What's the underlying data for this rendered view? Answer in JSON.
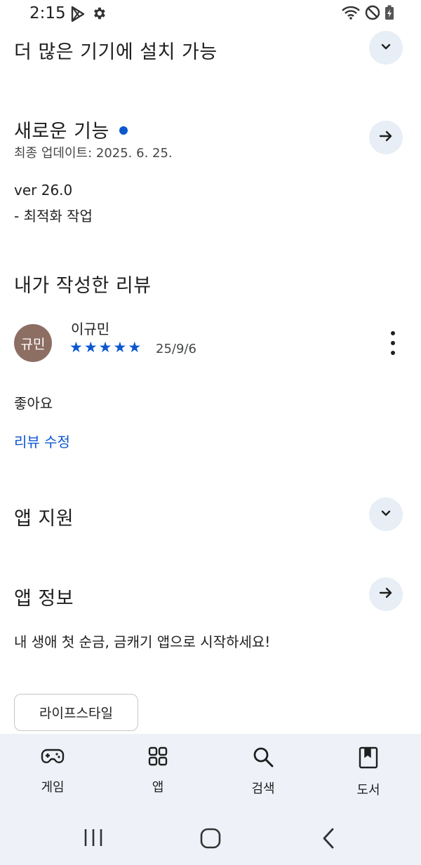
{
  "status_bar": {
    "time": "2:15",
    "left_icons": [
      "play-store-icon",
      "settings-gear-icon"
    ],
    "right_icons": [
      "wifi-icon",
      "do-not-disturb-icon",
      "battery-charging-icon"
    ]
  },
  "devices_section": {
    "title": "더 많은 기기에 설치 가능",
    "toggle_icon": "chevron-down-icon"
  },
  "whats_new": {
    "title": "새로운 기능",
    "last_updated": "최종 업데이트: 2025. 6. 25.",
    "version": "ver 26.0",
    "notes": "- 최적화 작업",
    "arrow_icon": "arrow-right-icon"
  },
  "my_review": {
    "title": "내가 작성한 리뷰",
    "avatar_initials": "규민",
    "reviewer_name": "이규민",
    "rating": 5,
    "stars": [
      "★",
      "★",
      "★",
      "★",
      "★"
    ],
    "date": "25/9/6",
    "text": "좋아요",
    "edit_label": "리뷰 수정"
  },
  "app_support": {
    "title": "앱 지원",
    "toggle_icon": "chevron-down-icon"
  },
  "app_info": {
    "title": "앱 정보",
    "description": "내 생애 첫 순금, 금캐기 앱으로 시작하세요!",
    "category_chip": "라이프스타일",
    "arrow_icon": "arrow-right-icon"
  },
  "bottom_nav": {
    "items": [
      {
        "label": "게임",
        "icon": "gamepad-icon"
      },
      {
        "label": "앱",
        "icon": "apps-grid-icon"
      },
      {
        "label": "검색",
        "icon": "search-icon"
      },
      {
        "label": "도서",
        "icon": "book-icon"
      }
    ]
  },
  "system_nav": [
    "recents-icon",
    "home-icon",
    "back-icon"
  ],
  "colors": {
    "accent": "#0b57d0",
    "button_bg": "#e8eef6",
    "nav_bg": "#eef2f8",
    "avatar_bg": "#8d6e63"
  }
}
